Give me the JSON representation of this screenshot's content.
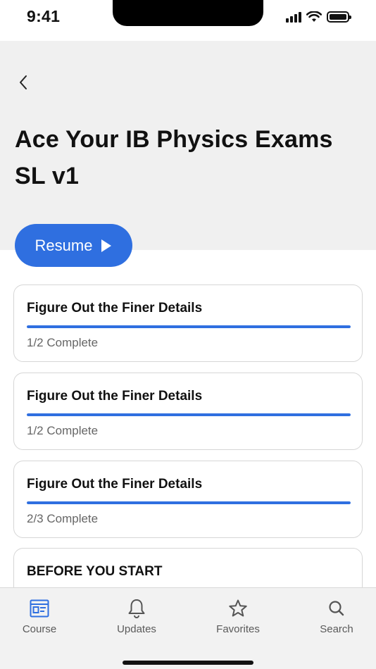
{
  "status_bar": {
    "time": "9:41"
  },
  "header": {
    "back_icon": "chevron-left-icon",
    "title": "Ace Your IB Physics Exams SL v1"
  },
  "resume_button": {
    "label": "Resume",
    "icon": "play-icon",
    "color": "#2f6fe0"
  },
  "sections": [
    {
      "title": "Figure Out the Finer Details",
      "status": "1/2 Complete",
      "progress": 1.0
    },
    {
      "title": "Figure Out the Finer Details",
      "status": "1/2 Complete",
      "progress": 1.0
    },
    {
      "title": "Figure Out the Finer Details",
      "status": "2/3 Complete",
      "progress": 1.0
    },
    {
      "title": "BEFORE YOU START"
    }
  ],
  "tab_bar": {
    "tabs": [
      {
        "label": "Course",
        "icon": "course-icon",
        "active": true
      },
      {
        "label": "Updates",
        "icon": "bell-icon"
      },
      {
        "label": "Favorites",
        "icon": "star-icon"
      },
      {
        "label": "Search",
        "icon": "search-icon"
      }
    ],
    "active_color": "#2f6fe0"
  }
}
